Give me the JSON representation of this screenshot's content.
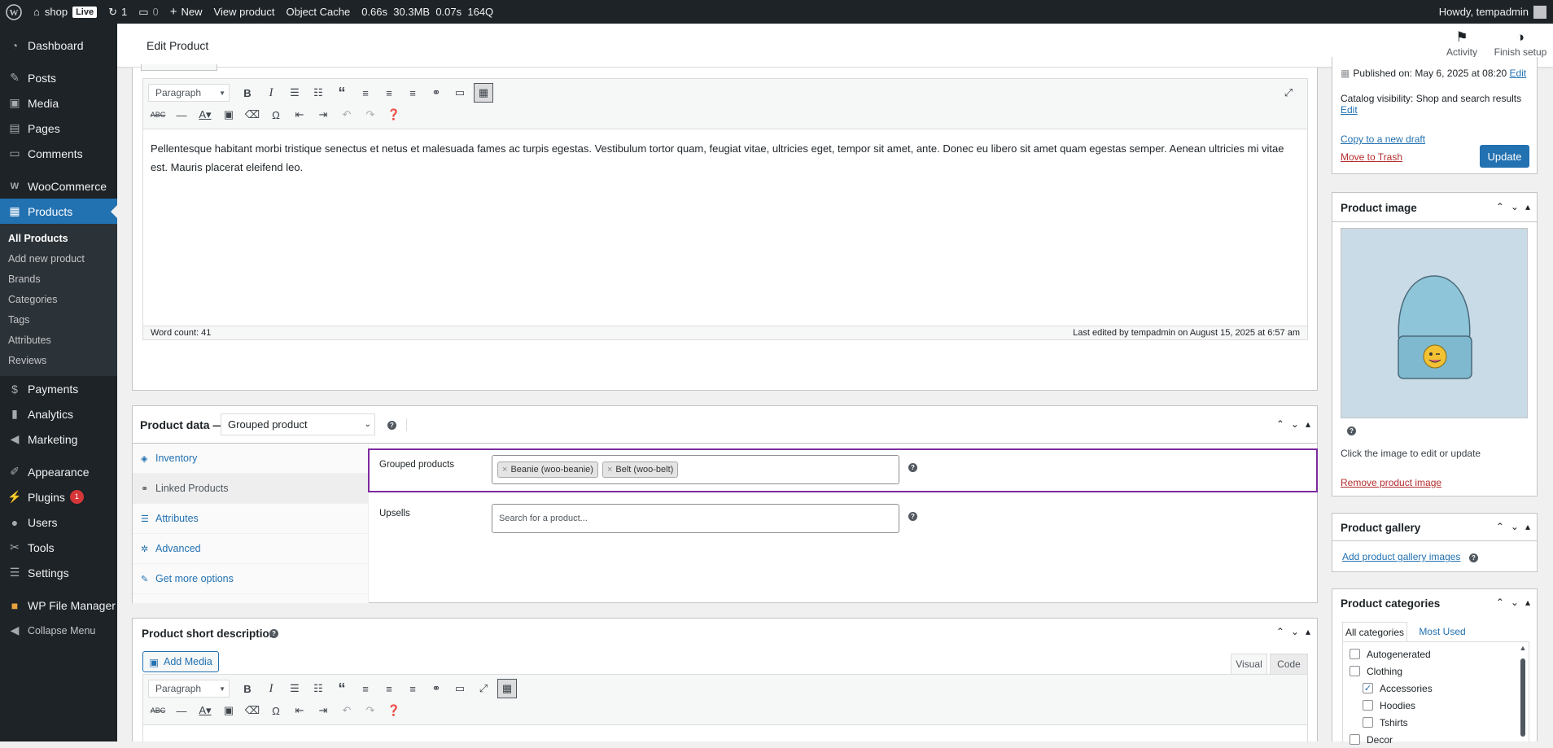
{
  "admin_bar": {
    "site_name": "shop",
    "live_badge": "Live",
    "updates_count": "1",
    "comments_count": "0",
    "new_label": "New",
    "view_product": "View product",
    "object_cache": "Object Cache",
    "perf_time": "0.66s",
    "perf_memory": "30.3MB",
    "perf_query_time": "0.07s",
    "perf_queries": "164Q",
    "howdy": "Howdy, tempadmin"
  },
  "sidebar": {
    "items": [
      {
        "label": "Dashboard",
        "icon": "dashboard-icon"
      },
      {
        "label": "Posts",
        "icon": "pin-icon"
      },
      {
        "label": "Media",
        "icon": "media-icon"
      },
      {
        "label": "Pages",
        "icon": "pages-icon"
      },
      {
        "label": "Comments",
        "icon": "comment-icon"
      },
      {
        "label": "WooCommerce",
        "icon": "woo-icon"
      },
      {
        "label": "Products",
        "icon": "archive-icon"
      },
      {
        "label": "Payments",
        "icon": "payments-icon"
      },
      {
        "label": "Analytics",
        "icon": "chart-icon"
      },
      {
        "label": "Marketing",
        "icon": "megaphone-icon"
      },
      {
        "label": "Appearance",
        "icon": "brush-icon"
      },
      {
        "label": "Plugins",
        "icon": "plug-icon",
        "badge": "1"
      },
      {
        "label": "Users",
        "icon": "users-icon"
      },
      {
        "label": "Tools",
        "icon": "wrench-icon"
      },
      {
        "label": "Settings",
        "icon": "sliders-icon"
      },
      {
        "label": "WP File Manager",
        "icon": "folder-icon"
      },
      {
        "label": "Collapse Menu",
        "icon": "collapse-icon"
      }
    ],
    "products_submenu": [
      "All Products",
      "Add new product",
      "Brands",
      "Categories",
      "Tags",
      "Attributes",
      "Reviews"
    ]
  },
  "header": {
    "title": "Edit Product",
    "activity": "Activity",
    "finish_setup": "Finish setup"
  },
  "editor": {
    "format_select": "Paragraph",
    "content": "Pellentesque habitant morbi tristique senectus et netus et malesuada fames ac turpis egestas. Vestibulum tortor quam, feugiat vitae, ultricies eget, tempor sit amet, ante. Donec eu libero sit amet quam egestas semper. Aenean ultricies mi vitae est. Mauris placerat eleifend leo.",
    "word_count": "Word count: 41",
    "last_edited": "Last edited by tempadmin on August 15, 2025 at 6:57 am"
  },
  "product_data": {
    "title": "Product data —",
    "type_select": "Grouped product",
    "tabs": [
      {
        "label": "Inventory",
        "icon": "tag-icon"
      },
      {
        "label": "Linked Products",
        "icon": "link-icon"
      },
      {
        "label": "Attributes",
        "icon": "list-icon"
      },
      {
        "label": "Advanced",
        "icon": "gear-icon"
      },
      {
        "label": "Get more options",
        "icon": "plugin-icon"
      }
    ],
    "grouped_label": "Grouped products",
    "grouped_chips": [
      "Beanie (woo-beanie)",
      "Belt (woo-belt)"
    ],
    "upsells_label": "Upsells",
    "upsells_placeholder": "Search for a product..."
  },
  "short_description": {
    "title": "Product short description",
    "add_media": "Add Media",
    "tab_visual": "Visual",
    "tab_code": "Code",
    "format_select": "Paragraph"
  },
  "publish": {
    "published_on": "Published on:",
    "published_date": "May 6, 2025 at 08:20",
    "edit": "Edit",
    "catalog_label": "Catalog visibility:",
    "catalog_value": "Shop and search results",
    "catalog_edit": "Edit",
    "copy_draft": "Copy to a new draft",
    "move_trash": "Move to Trash",
    "update": "Update"
  },
  "product_image": {
    "title": "Product image",
    "hint": "Click the image to edit or update",
    "remove": "Remove product image"
  },
  "product_gallery": {
    "title": "Product gallery",
    "add": "Add product gallery images"
  },
  "product_categories": {
    "title": "Product categories",
    "tab_all": "All categories",
    "tab_used": "Most Used",
    "items": [
      {
        "label": "Autogenerated",
        "checked": false,
        "level": 0
      },
      {
        "label": "Clothing",
        "checked": false,
        "level": 0
      },
      {
        "label": "Accessories",
        "checked": true,
        "level": 1
      },
      {
        "label": "Hoodies",
        "checked": false,
        "level": 1
      },
      {
        "label": "Tshirts",
        "checked": false,
        "level": 1
      },
      {
        "label": "Decor",
        "checked": false,
        "level": 0
      }
    ]
  },
  "colors": {
    "accent": "#2271b1",
    "adminbar": "#1d2327",
    "highlight": "#7e2a9e"
  }
}
